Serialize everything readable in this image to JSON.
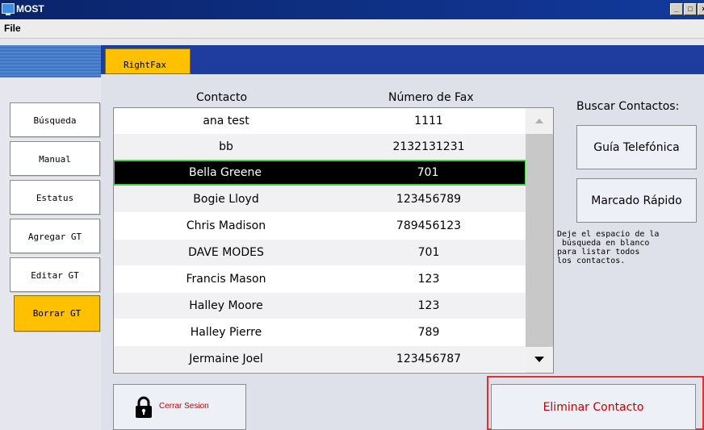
{
  "window": {
    "title": "MOST"
  },
  "menu": {
    "file": "File"
  },
  "tab": {
    "label": "RightFax"
  },
  "nav": [
    {
      "label": "Búsqueda"
    },
    {
      "label": "Manual"
    },
    {
      "label": "Estatus"
    },
    {
      "label": "Agregar GT"
    },
    {
      "label": "Editar GT"
    },
    {
      "label": "Borrar GT",
      "active": true
    }
  ],
  "table": {
    "headers": {
      "contact": "Contacto",
      "fax": "Número de Fax"
    },
    "rows": [
      {
        "contact": "ana test",
        "fax": "1111"
      },
      {
        "contact": "bb",
        "fax": "2132131231"
      },
      {
        "contact": "Bella Greene",
        "fax": "701",
        "selected": true
      },
      {
        "contact": "Bogie Lloyd",
        "fax": "123456789"
      },
      {
        "contact": "Chris Madison",
        "fax": "789456123"
      },
      {
        "contact": "DAVE MODES",
        "fax": "701"
      },
      {
        "contact": "Francis Mason",
        "fax": "123"
      },
      {
        "contact": "Halley Moore",
        "fax": "123"
      },
      {
        "contact": "Halley Pierre",
        "fax": "789"
      },
      {
        "contact": "Jermaine Joel",
        "fax": "123456787"
      }
    ]
  },
  "search": {
    "label": "Buscar Contactos:",
    "phonebook_button": "Guía Telefónica",
    "speed_dial_button": "Marcado Rápido",
    "hint": "Deje el espacio de la\n búsqueda en blanco\npara listar todos\nlos contactos."
  },
  "actions": {
    "logout": "Cerrar Sesion",
    "delete_contact": "Eliminar Contacto"
  },
  "icons": {
    "app": "app-icon",
    "lock": "lock-icon"
  },
  "colors": {
    "accent": "#ffc000",
    "header_blue": "#1f3d9e",
    "selection": "#000000",
    "selection_outline": "#3cd43c",
    "danger": "#c00000"
  }
}
